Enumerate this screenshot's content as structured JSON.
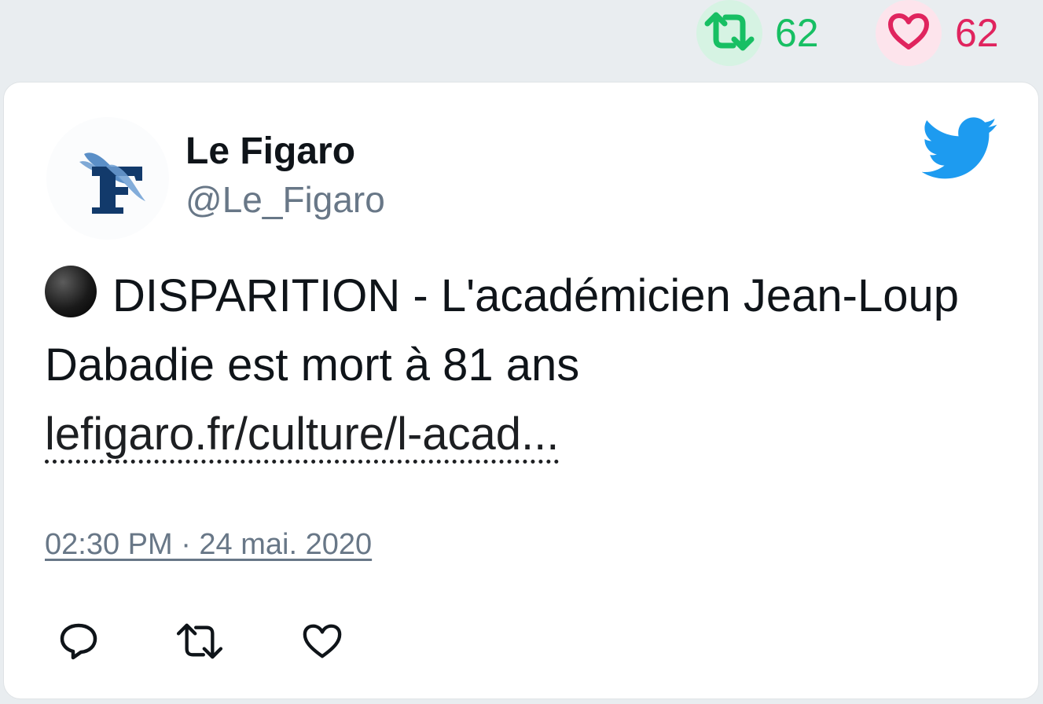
{
  "stats": {
    "retweet_count": "62",
    "like_count": "62"
  },
  "author": {
    "name": "Le Figaro",
    "handle": "@Le_Figaro"
  },
  "tweet": {
    "text": "DISPARITION - L'académicien Jean-Loup Dabadie est mort à 81 ans",
    "link_text": "lefigaro.fr/culture/l-acad...",
    "timestamp": "02:30 PM · 24 mai. 2020"
  },
  "colors": {
    "retweet": "#17bf63",
    "like": "#e0245e",
    "twitter_blue": "#1d9bf0",
    "muted_text": "#687787"
  },
  "icons": {
    "retweet": "retweet-icon",
    "like": "heart-icon",
    "reply": "reply-icon",
    "brand": "twitter-bird-icon",
    "bullet": "black-circle-icon"
  }
}
